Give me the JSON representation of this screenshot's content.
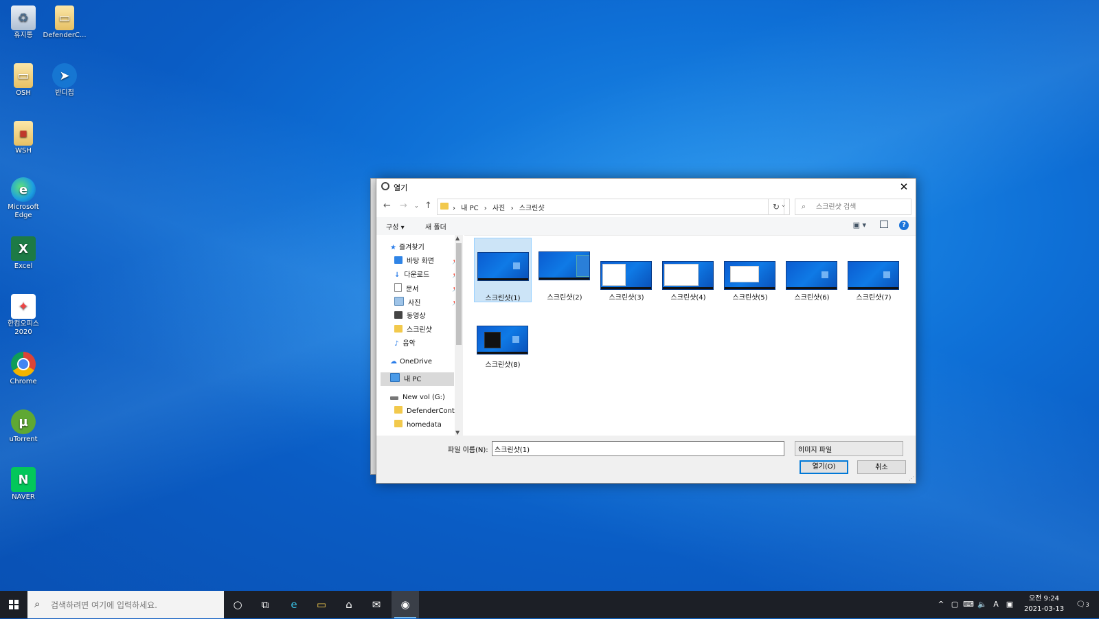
{
  "desktop": {
    "icons": [
      {
        "label": "휴지통",
        "icon": "recycle-bin-icon"
      },
      {
        "label": "DefenderC...",
        "icon": "folder-icon"
      },
      {
        "label": "OSH",
        "icon": "folder-icon"
      },
      {
        "label": "반디집",
        "icon": "bandizip-icon"
      },
      {
        "label": "WSH",
        "icon": "folder-icon"
      },
      {
        "label": "Microsoft Edge",
        "icon": "edge-icon"
      },
      {
        "label": "Excel",
        "icon": "excel-icon"
      },
      {
        "label": "한컴오피스 2020",
        "icon": "hancom-icon"
      },
      {
        "label": "Chrome",
        "icon": "chrome-icon"
      },
      {
        "label": "uTorrent",
        "icon": "utorrent-icon"
      },
      {
        "label": "NAVER",
        "icon": "naver-icon"
      }
    ]
  },
  "dialog": {
    "title": "열기",
    "breadcrumb": [
      "내 PC",
      "사진",
      "스크린샷"
    ],
    "search_placeholder": "스크린샷 검색",
    "toolbar": {
      "organize": "구성 ▾",
      "new_folder": "새 폴더"
    },
    "nav": {
      "quick_access": "즐겨찾기",
      "items": [
        {
          "label": "바탕 화면",
          "pinned": true
        },
        {
          "label": "다운로드",
          "pinned": true
        },
        {
          "label": "문서",
          "pinned": true
        },
        {
          "label": "사진",
          "pinned": true
        },
        {
          "label": "동영상",
          "pinned": false
        },
        {
          "label": "스크린샷",
          "pinned": false
        },
        {
          "label": "음악",
          "pinned": false
        }
      ],
      "onedrive": "OneDrive",
      "this_pc": "내 PC",
      "drive": "New vol (G:)",
      "drive_items": [
        "DefenderContro",
        "homedata"
      ]
    },
    "files": [
      "스크린샷(1)",
      "스크린샷(2)",
      "스크린샷(3)",
      "스크린샷(4)",
      "스크린샷(5)",
      "스크린샷(6)",
      "스크린샷(7)",
      "스크린샷(8)"
    ],
    "selected_file": "스크린샷(1)",
    "filename_label": "파일 이름(N):",
    "filename_value": "스크린샷(1)",
    "filetype_value": "이미지 파일",
    "open_button": "열기(O)",
    "cancel_button": "취소"
  },
  "taskbar": {
    "search_placeholder": "검색하려면 여기에 입력하세요.",
    "clock_time": "오전 9:24",
    "clock_date": "2021-03-13",
    "ime_label": "A",
    "notification_count": "3"
  },
  "colors": {
    "accent": "#0078d7",
    "selection": "#cce4f7",
    "taskbar": "#1c1f26"
  }
}
